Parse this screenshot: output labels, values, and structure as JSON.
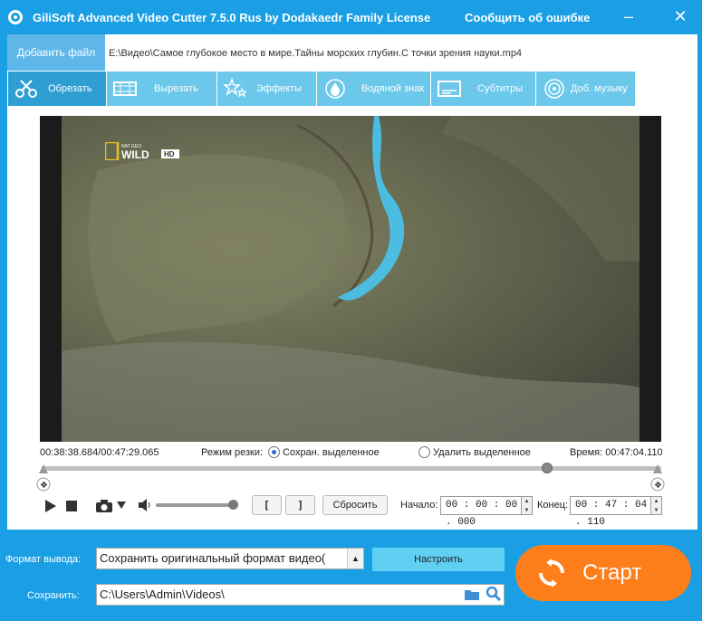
{
  "window": {
    "title": "GiliSoft Advanced Video Cutter 7.5.0 Rus by Dodakaedr Family License",
    "report_link": "Сообщить об ошибке",
    "app_icon": "film-icon"
  },
  "file": {
    "add_button": "Добавить файл",
    "path": "E:\\Видео\\Самое глубокое место в мире.Тайны морских глубин.С точки зрения науки.mp4"
  },
  "tabs": [
    {
      "label": "Обрезать",
      "icon": "scissors-icon",
      "active": true
    },
    {
      "label": "Вырезать",
      "icon": "film-strip-icon",
      "active": false
    },
    {
      "label": "Эффекты",
      "icon": "stars-icon",
      "active": false
    },
    {
      "label": "Водяной знак",
      "icon": "drop-icon",
      "active": false
    },
    {
      "label": "Субтитры",
      "icon": "subtitle-icon",
      "active": false
    },
    {
      "label": "Доб. музыку",
      "icon": "music-icon",
      "active": false
    }
  ],
  "video": {
    "logo_small": "NAT GEO",
    "logo_main": "WILD",
    "logo_badge": "HD"
  },
  "playback": {
    "current": "00:38:38.684",
    "separator": "/",
    "total": "00:47:29.065",
    "mode_label": "Режим резки:",
    "mode_keep": "Сохран. выделенное",
    "mode_delete": "Удалить выделенное",
    "duration": "Время: 00:47:04.110",
    "seek_fraction": 0.82,
    "volume_fraction": 0.92
  },
  "controls": {
    "mark_start": "[",
    "mark_end": "]",
    "reset": "Сбросить",
    "start_label": "Начало:",
    "start_value": "00 : 00 : 00 . 000",
    "end_label": "Конец:",
    "end_value": "00 : 47 : 04 . 110"
  },
  "output": {
    "format_label": "Формат вывода:",
    "format_value": "Сохранить оригинальный формат видео(",
    "configure": "Настроить",
    "save_label": "Сохранить:",
    "save_path": "C:\\Users\\Admin\\Videos\\",
    "start_button": "Старт"
  },
  "colors": {
    "accent": "#1a9fe5",
    "tab": "#6cc8ea",
    "tab_active": "#2f9fd3",
    "start": "#ff7e1c",
    "configure": "#5fcff2"
  }
}
